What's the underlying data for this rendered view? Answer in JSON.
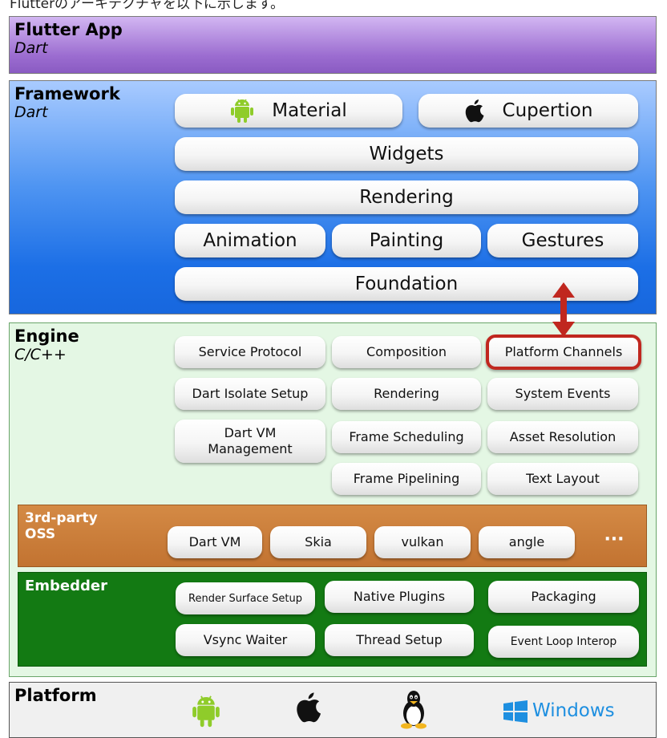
{
  "caption": "Flutterのアーキテクチャを以下に示します。",
  "flutter_app": {
    "title": "Flutter App",
    "language": "Dart"
  },
  "framework": {
    "title": "Framework",
    "language": "Dart",
    "material": "Material",
    "cupertino": "Cupertion",
    "widgets": "Widgets",
    "rendering": "Rendering",
    "animation": "Animation",
    "painting": "Painting",
    "gestures": "Gestures",
    "foundation": "Foundation"
  },
  "engine": {
    "title": "Engine",
    "language": "C/C++",
    "modules": {
      "service_protocol": "Service Protocol",
      "composition": "Composition",
      "platform_channels": "Platform Channels",
      "dart_isolate_setup": "Dart Isolate Setup",
      "rendering": "Rendering",
      "system_events": "System Events",
      "dart_vm_management_1": "Dart VM",
      "dart_vm_management_2": "Management",
      "frame_scheduling": "Frame Scheduling",
      "asset_resolution": "Asset Resolution",
      "frame_pipelining": "Frame Pipelining",
      "text_layout": "Text Layout"
    }
  },
  "oss": {
    "title_line1": "3rd-party",
    "title_line2": "OSS",
    "items": [
      "Dart VM",
      "Skia",
      "vulkan",
      "angle"
    ],
    "more": "···"
  },
  "embedder": {
    "title": "Embedder",
    "items": {
      "render_surface_setup": "Render Surface Setup",
      "native_plugins": "Native Plugins",
      "packaging": "Packaging",
      "vsync_waiter": "Vsync Waiter",
      "thread_setup": "Thread Setup",
      "event_loop_interop": "Event Loop Interop"
    }
  },
  "platform": {
    "title": "Platform",
    "windows_label": "Windows"
  },
  "colors": {
    "flutter_app": "#a47ad6",
    "framework": "#2d7fe8",
    "engine": "#e4f7e4",
    "oss": "#c97934",
    "embedder": "#137a13",
    "android": "#8fcc2a",
    "highlight": "#c0271f",
    "windows": "#1e8fe0"
  }
}
